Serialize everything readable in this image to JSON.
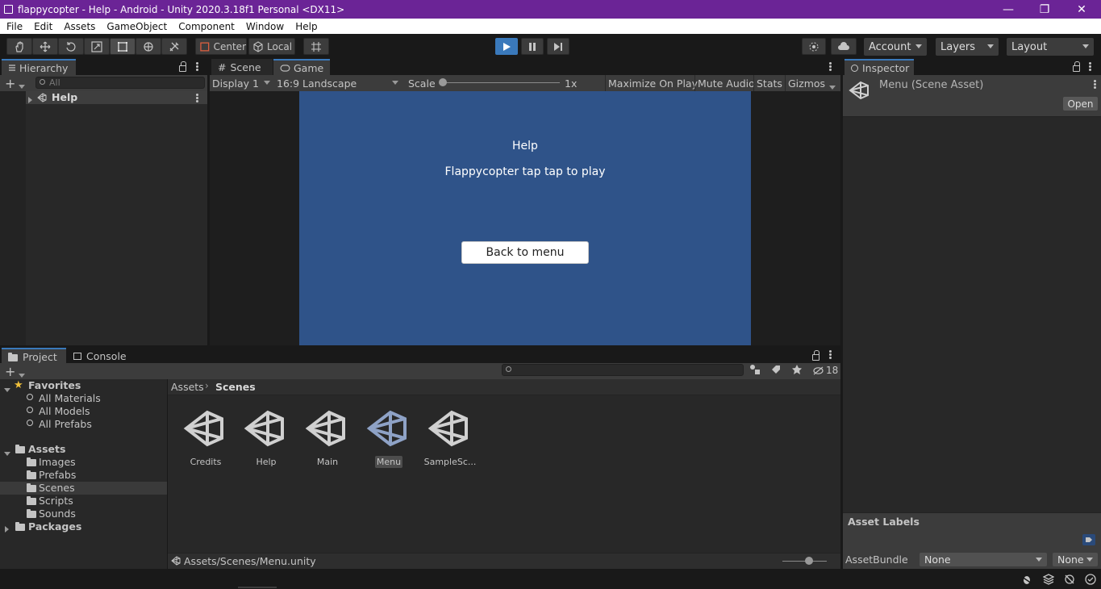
{
  "window": {
    "title": "flappycopter - Help - Android - Unity 2020.3.18f1 Personal <DX11>",
    "controls": [
      "—",
      "❐",
      "✕"
    ]
  },
  "menubar": [
    "File",
    "Edit",
    "Assets",
    "GameObject",
    "Component",
    "Window",
    "Help"
  ],
  "toolbar": {
    "pivot_label": "Center",
    "space_label": "Local",
    "account_label": "Account",
    "layers_label": "Layers",
    "layout_label": "Layout"
  },
  "hierarchy": {
    "tab_label": "Hierarchy",
    "search_placeholder": "All",
    "scene_item": "Help"
  },
  "game_view": {
    "tabs": [
      "Scene",
      "Game"
    ],
    "display": "Display 1",
    "aspect": "16:9 Landscape",
    "scale_label": "Scale",
    "scale_value": "1x",
    "maximize_on_play": "Maximize On Play",
    "mute_audio": "Mute Audio",
    "stats": "Stats",
    "gizmos": "Gizmos",
    "scene_bg_color": "#2f5389",
    "scene_title": "Help",
    "scene_text": "Flappycopter tap tap to play",
    "scene_button": "Back to menu"
  },
  "inspector": {
    "tab_label": "Inspector",
    "asset_title": "Menu (Scene Asset)",
    "open_button": "Open",
    "asset_labels": "Asset Labels",
    "asset_bundle_label": "AssetBundle",
    "asset_bundle_value": "None",
    "asset_bundle_variant": "None"
  },
  "project": {
    "tabs": [
      "Project",
      "Console"
    ],
    "hidden_count": "18",
    "favorites_label": "Favorites",
    "favorites": [
      "All Materials",
      "All Models",
      "All Prefabs"
    ],
    "assets_label": "Assets",
    "asset_folders": [
      "Images",
      "Prefabs",
      "Scenes",
      "Scripts",
      "Sounds"
    ],
    "packages_label": "Packages",
    "breadcrumb": [
      "Assets",
      "Scenes"
    ],
    "scenes": [
      "Credits",
      "Help",
      "Main",
      "Menu",
      "SampleSc..."
    ],
    "selected_scene": "Menu",
    "status_path": "Assets/Scenes/Menu.unity"
  },
  "colors": {
    "accent": "#3a79bb",
    "title_bar": "#6b2496",
    "play_active": "#3a79bb"
  }
}
